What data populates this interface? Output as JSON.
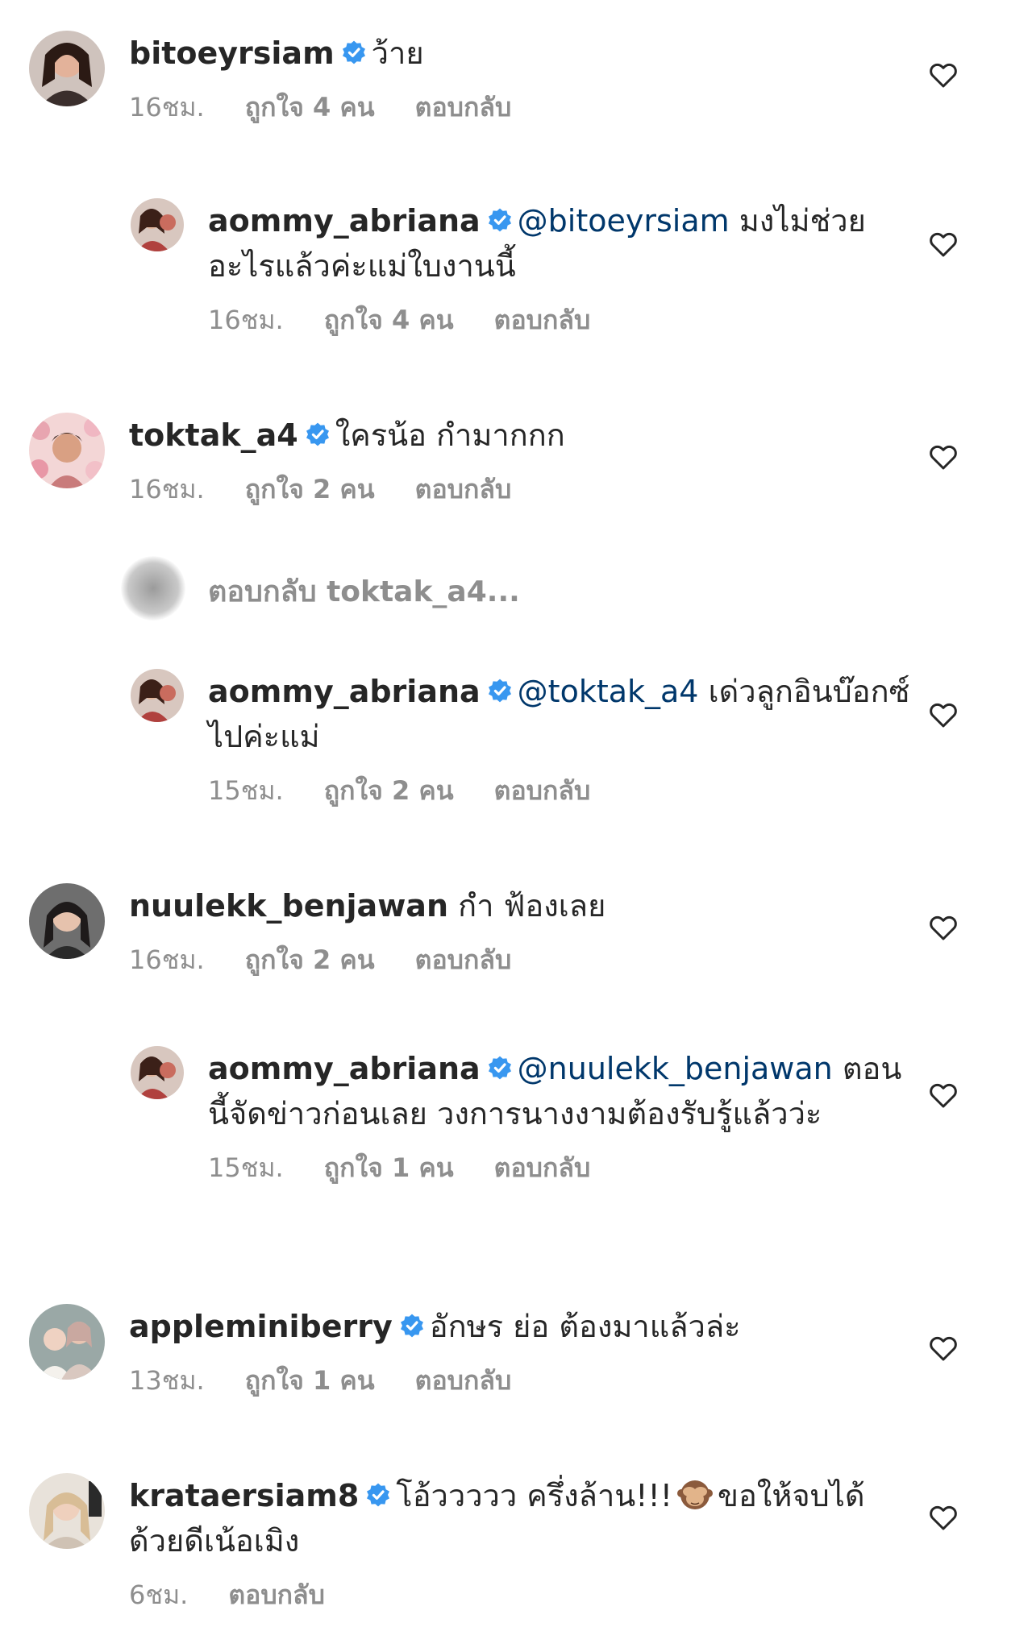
{
  "comments": [
    {
      "username": "bitoeyrsiam",
      "verified": true,
      "text": "ว้าย",
      "time": "16ชม.",
      "likes": "ถูกใจ 4 คน",
      "reply_label": "ตอบกลับ",
      "avatar_color": "#6b3a2a"
    },
    {
      "username": "aommy_abriana",
      "verified": true,
      "mention": "@bitoeyrsiam",
      "text": "มงไม่ช่วยอะไรแล้วค่ะแม่ใบงานนี้",
      "time": "16ชม.",
      "likes": "ถูกใจ 4 คน",
      "reply_label": "ตอบกลับ",
      "avatar_color": "#b0413e"
    },
    {
      "username": "toktak_a4",
      "verified": true,
      "text": "ใครน้อ กำมากกก",
      "time": "16ชม.",
      "likes": "ถูกใจ 2 คน",
      "reply_label": "ตอบกลับ",
      "avatar_color": "#d9859a"
    },
    {
      "username": "aommy_abriana",
      "verified": true,
      "mention": "@toktak_a4",
      "text": "เด่วลูกอินบ๊อกซ์ไปค่ะแม่",
      "time": "15ชม.",
      "likes": "ถูกใจ 2 คน",
      "reply_label": "ตอบกลับ",
      "avatar_color": "#b0413e"
    },
    {
      "username": "nuulekk_benjawan",
      "verified": false,
      "text": "กำ ฟ้องเลย",
      "time": "16ชม.",
      "likes": "ถูกใจ 2 คน",
      "reply_label": "ตอบกลับ",
      "avatar_color": "#3a3a3a"
    },
    {
      "username": "aommy_abriana",
      "verified": true,
      "mention": "@nuulekk_benjawan",
      "text": "ตอนนี้จัดข่าวก่อนเลย วงการนางงามต้องรับรู้แล้วว่ะ",
      "time": "15ชม.",
      "likes": "ถูกใจ 1 คน",
      "reply_label": "ตอบกลับ",
      "avatar_color": "#b0413e"
    },
    {
      "username": "appleminiberry",
      "verified": true,
      "text": "อักษร ย่อ ต้องมาแล้วล่ะ",
      "time": "13ชม.",
      "likes": "ถูกใจ 1 คน",
      "reply_label": "ตอบกลับ",
      "avatar_color": "#8a9a9a"
    },
    {
      "username": "krataersiam8",
      "verified": true,
      "text": "โอ้ววววว ครึ่งล้าน!!!",
      "emoji": "see-no-evil-monkey",
      "text2": "ขอให้จบได้ด้วยดีเน้อเมิง",
      "time": "6ชม.",
      "reply_label": "ตอบกลับ",
      "avatar_color": "#c9b79a"
    }
  ],
  "view_replies": "ตอบกลับ toktak_a4...",
  "colors": {
    "verified": "#3897f0",
    "mention": "#00376b",
    "meta": "#8e8e8e"
  }
}
